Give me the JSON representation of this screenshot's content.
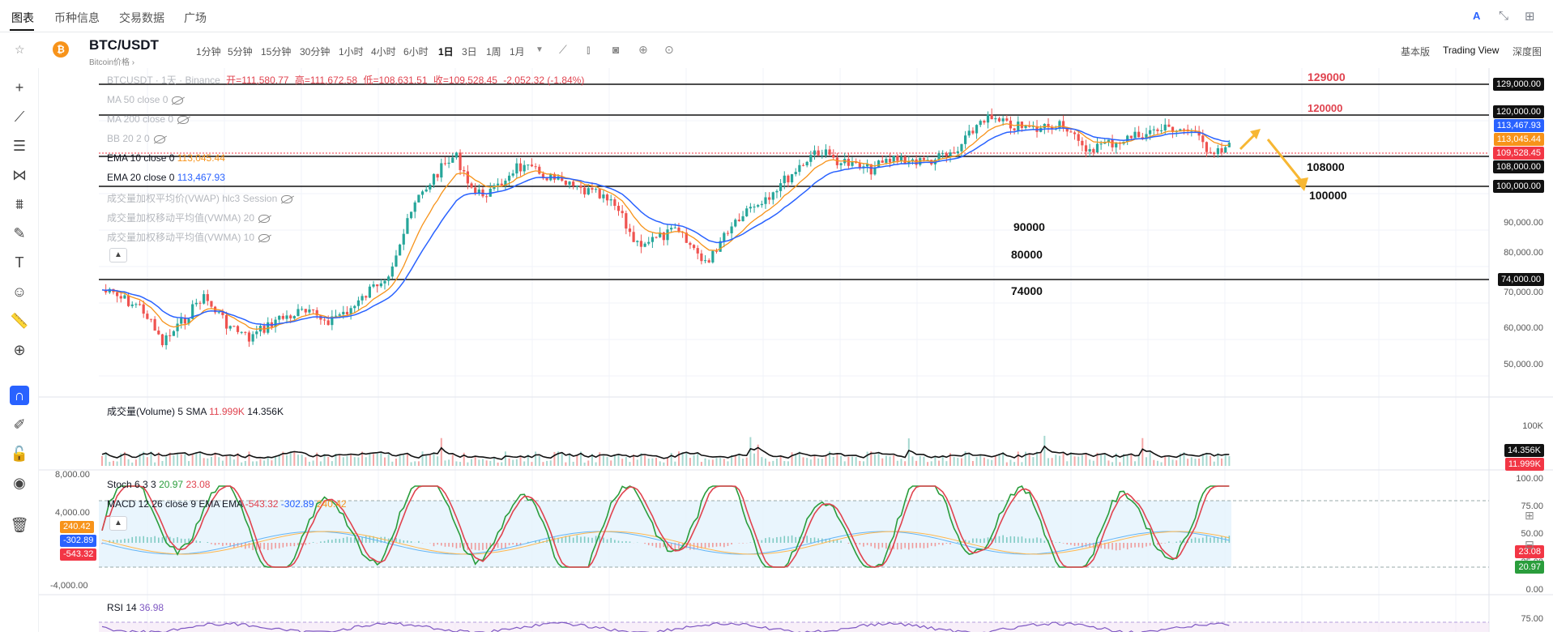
{
  "topnav": {
    "tabs": [
      "图表",
      "币种信息",
      "交易数据",
      "广场"
    ],
    "active_tab": 0,
    "right_icons": [
      "ai-icon",
      "collapse-arrows-icon",
      "grid-icon"
    ]
  },
  "symbol": {
    "name": "BTC/USDT",
    "subtitle": "Bitcoin价格 ›",
    "logo": "bitcoin-logo",
    "logo_color": "#f7931a"
  },
  "intervals": [
    "1分钟",
    "5分钟",
    "15分钟",
    "30分钟",
    "1小时",
    "4小时",
    "6小时",
    "1日",
    "3日",
    "1周",
    "1月"
  ],
  "active_interval": "1日",
  "views": [
    "基本版",
    "Trading View",
    "深度图"
  ],
  "active_view": "Trading View",
  "ohlc": {
    "label": "BTCUSDT · 1天 · Binance",
    "open_label": "开=",
    "open": "111,580.77",
    "high_label": "高=",
    "high": "111,672.58",
    "low_label": "低=",
    "low": "108,631.51",
    "close_label": "收=",
    "close": "109,528.45",
    "change": "-2,052.32 (-1.84%)"
  },
  "indicators": {
    "ma50": "MA 50 close 0",
    "ma200": "MA 200 close 0",
    "bb": "BB 20 2 0",
    "ema10": {
      "label": "EMA 10 close 0",
      "value": "113,045.44"
    },
    "ema20": {
      "label": "EMA 20 close 0",
      "value": "113,467.93"
    },
    "vwap": "成交量加权平均价(VWAP) hlc3 Session",
    "vwma20": "成交量加权移动平均值(VWMA) 20",
    "vwma10": "成交量加权移动平均值(VWMA) 10"
  },
  "price_axis": {
    "labels": [
      "90,000.00",
      "80,000.00",
      "70,000.00",
      "60,000.00",
      "50,000.00"
    ],
    "tags": [
      {
        "text": "129,000.00",
        "color": "#111111"
      },
      {
        "text": "120,000.00",
        "color": "#111111"
      },
      {
        "text": "113,467.93",
        "color": "#2962ff"
      },
      {
        "text": "113,045.44",
        "color": "#f7931a"
      },
      {
        "text": "109,528.45",
        "color": "#f23645"
      },
      {
        "text": "108,000.00",
        "color": "#111111"
      },
      {
        "text": "100,000.00",
        "color": "#111111"
      },
      {
        "text": "74,000.00",
        "color": "#111111"
      }
    ]
  },
  "annotations": {
    "l129000": "129000",
    "l120000": "120000",
    "l108000": "108000",
    "l100000": "100000",
    "l90000": "90000",
    "l80000": "80000",
    "l74000": "74000"
  },
  "volume": {
    "label": "成交量(Volume)",
    "sma": "5 SMA",
    "v1": "11.999K",
    "v2": "14.356K",
    "axis_100k": "100K",
    "tag1": "14.356K",
    "tag2": "11.999K"
  },
  "stoch": {
    "label": "Stoch 6 3 3",
    "k": "20.97",
    "d": "23.08",
    "axis": [
      "100.00",
      "75.00",
      "50.00",
      "25.00",
      "0.00"
    ],
    "tag_d": "23.08",
    "tag_k": "20.97"
  },
  "macd": {
    "label": "MACD 12 26 close 9 EMA EMA",
    "v1": "-543.32",
    "v2": "-302.89",
    "v3": "240.42",
    "left_axis": [
      "8,000.00",
      "4,000.00",
      "-4,000.00"
    ],
    "box1": "240.42",
    "box2": "-302.89",
    "box3": "-543.32"
  },
  "rsi": {
    "label": "RSI 14",
    "value": "36.98",
    "axis_75": "75.00"
  }
}
